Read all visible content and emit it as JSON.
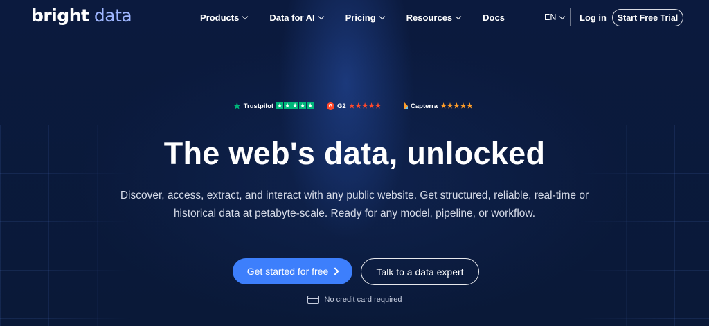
{
  "header": {
    "logo_word1": "bright",
    "logo_word2": "data",
    "nav": [
      {
        "label": "Products",
        "has_dropdown": true
      },
      {
        "label": "Data for AI",
        "has_dropdown": true
      },
      {
        "label": "Pricing",
        "has_dropdown": true
      },
      {
        "label": "Resources",
        "has_dropdown": true
      },
      {
        "label": "Docs",
        "has_dropdown": false
      }
    ],
    "language": "EN",
    "login": "Log in",
    "cta": "Start Free Trial"
  },
  "ratings": {
    "trustpilot": {
      "name": "Trustpilot",
      "stars": 5
    },
    "g2": {
      "logo": "G",
      "name": "G2",
      "stars": 4.5
    },
    "capterra": {
      "name": "Capterra",
      "stars": 5
    }
  },
  "hero": {
    "title": "The web's data, unlocked",
    "subtitle": "Discover, access, extract, and interact with any public website. Get structured, reliable, real-time or historical data at petabyte-scale. Ready for any model, pipeline, or workflow.",
    "primary_cta": "Get started for free",
    "secondary_cta": "Talk to a data expert",
    "note": "No credit card required"
  },
  "colors": {
    "background": "#0a1a3c",
    "primary": "#3d7ffc",
    "logo_accent": "#9fb6ff",
    "trustpilot": "#00b67a",
    "g2": "#ff492c",
    "capterra": "#ff9d28"
  }
}
